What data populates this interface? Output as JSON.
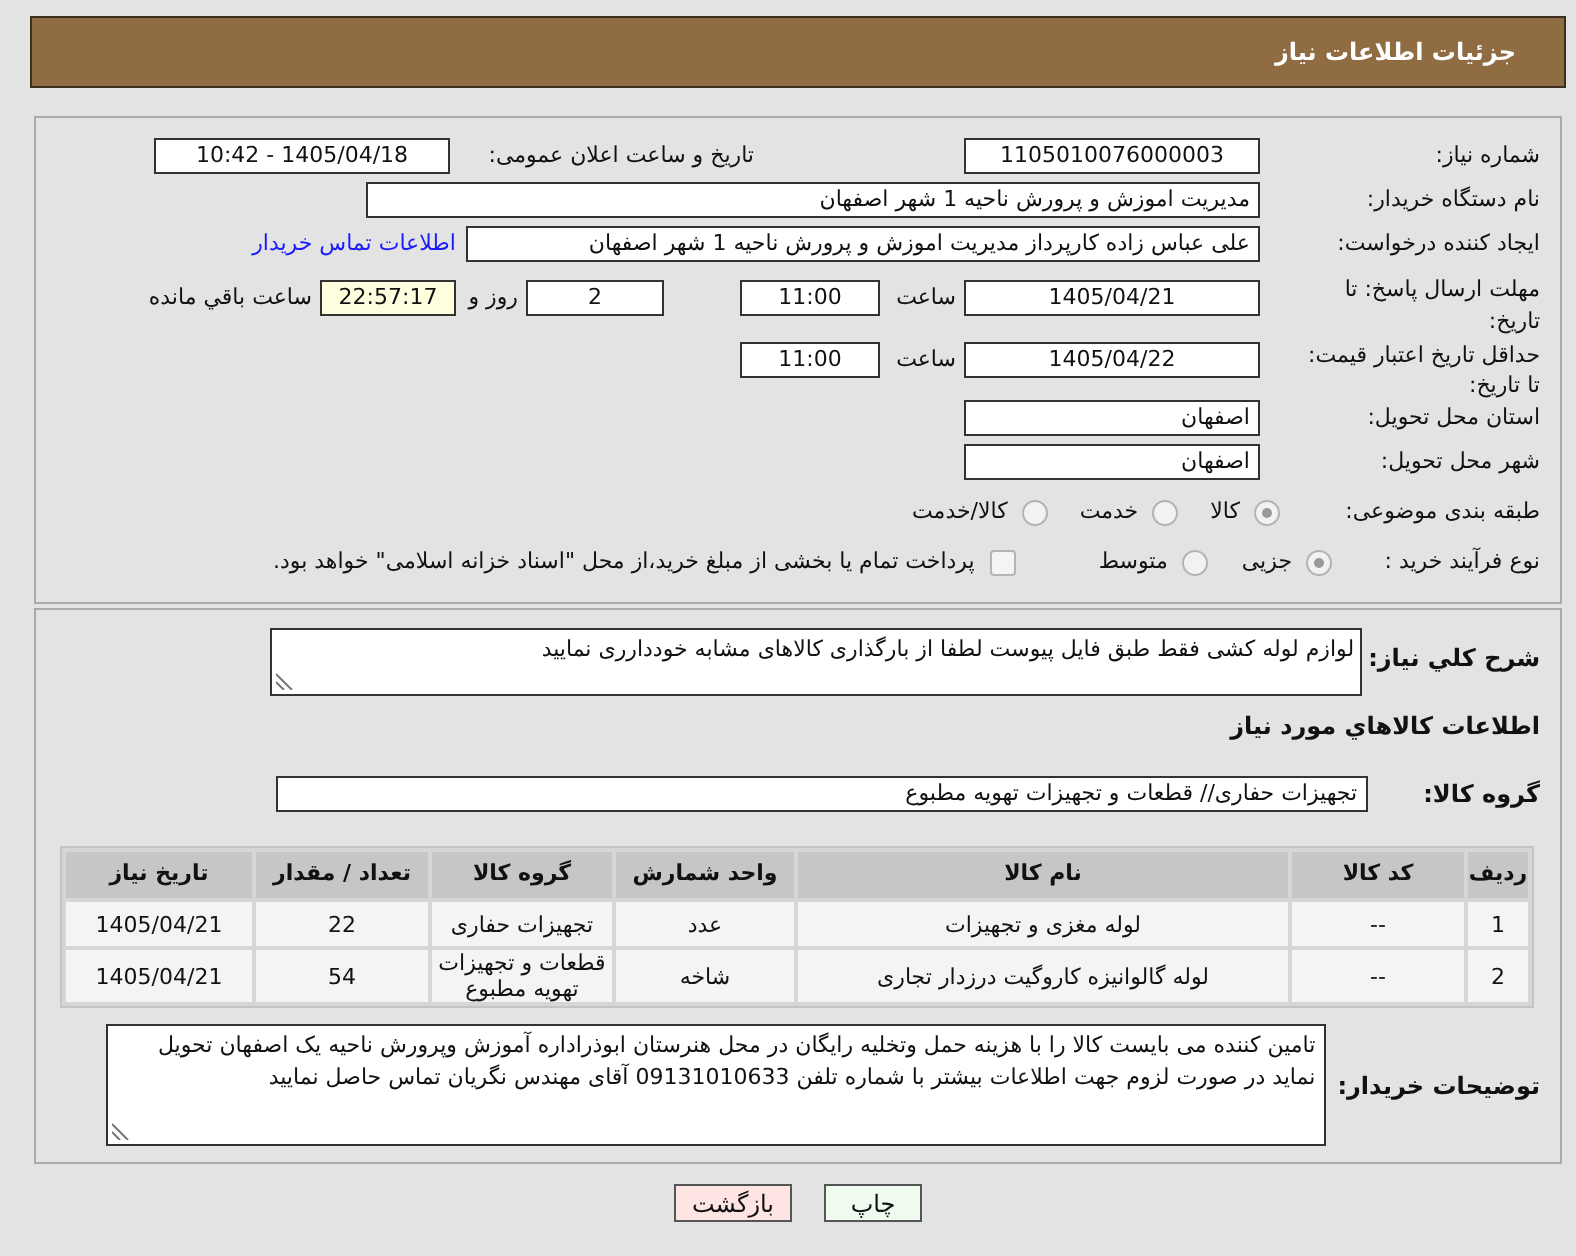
{
  "header": {
    "title": "جزئیات اطلاعات نیاز"
  },
  "need_number": {
    "label": "شماره نیاز:",
    "value": "1105010076000003"
  },
  "announcement": {
    "label": "تاریخ و ساعت اعلان عمومی:",
    "value": "1405/04/18 - 10:42"
  },
  "buyer_org": {
    "label": "نام دستگاه خریدار:",
    "value": "مدیریت اموزش و پرورش ناحیه 1 شهر اصفهان"
  },
  "requester": {
    "label": "ایجاد کننده درخواست:",
    "value": "علی عباس زاده کارپرداز مدیریت اموزش و پرورش ناحیه 1 شهر اصفهان",
    "contact_link": "اطلاعات تماس خریدار"
  },
  "response_deadline": {
    "label": "مهلت ارسال پاسخ: تا تاریخ:",
    "date": "1405/04/21",
    "time_label": "ساعت",
    "time": "11:00",
    "days": "2",
    "days_label": "روز و",
    "remaining": "22:57:17",
    "remaining_label": "ساعت باقي مانده"
  },
  "price_validity": {
    "label": "حداقل تاریخ اعتبار قیمت: تا تاریخ:",
    "date": "1405/04/22",
    "time_label": "ساعت",
    "time": "11:00"
  },
  "delivery_province": {
    "label": "استان محل تحویل:",
    "value": "اصفهان"
  },
  "delivery_city": {
    "label": "شهر محل تحویل:",
    "value": "اصفهان"
  },
  "classification": {
    "label": "طبقه بندی موضوعی:",
    "options": [
      {
        "label": "کالا",
        "selected": true
      },
      {
        "label": "خدمت",
        "selected": false
      },
      {
        "label": "کالا/خدمت",
        "selected": false
      }
    ]
  },
  "purchase_type": {
    "label": "نوع فرآیند خرید :",
    "options": [
      {
        "label": "جزیی",
        "selected": true
      },
      {
        "label": "متوسط",
        "selected": false
      }
    ],
    "treasury_payment": {
      "label": "پرداخت تمام یا بخشی از مبلغ خرید،از محل \"اسناد خزانه اسلامی\" خواهد بود.",
      "checked": false
    }
  },
  "description": {
    "label": "شرح کلي نياز:",
    "value": "لوازم لوله کشی  فقط طبق فایل پیوست لطفا از بارگذاری کالاهای  مشابه خوددارری نمایید"
  },
  "items_section": {
    "title": "اطلاعات کالاهاي مورد نياز",
    "group_label": "گروه کالا:",
    "group_value": "تجهیزات حفاری//  قطعات و تجهیزات تهویه مطبوع"
  },
  "table": {
    "columns": [
      "ردیف",
      "کد کالا",
      "نام کالا",
      "واحد شمارش",
      "گروه کالا",
      "تعداد / مقدار",
      "تاریخ نیاز"
    ],
    "rows": [
      [
        "1",
        "--",
        "لوله مغزی و تجهیزات",
        "عدد",
        "تجهیزات حفاری",
        "22",
        "1405/04/21"
      ],
      [
        "2",
        "--",
        "لوله گالوانیزه کاروگیت درزدار تجاری",
        "شاخه",
        "قطعات و تجهیزات تهویه مطبوع",
        "54",
        "1405/04/21"
      ]
    ]
  },
  "buyer_notes": {
    "label": "توضیحات خریدار:",
    "value": "تامین کننده می بایست کالا را با هزینه حمل وتخلیه  رایگان در محل  هنرستان ابوذراداره آموزش وپرورش ناحیه یک اصفهان تحویل نماید در صورت لزوم جهت اطلاعات بیشتر با شماره تلفن 09131010633 آقای مهندس نگریان تماس حاصل نمایید"
  },
  "buttons": [
    {
      "label": "چاپ",
      "kind": "print"
    },
    {
      "label": "بازگشت",
      "kind": "back"
    }
  ]
}
